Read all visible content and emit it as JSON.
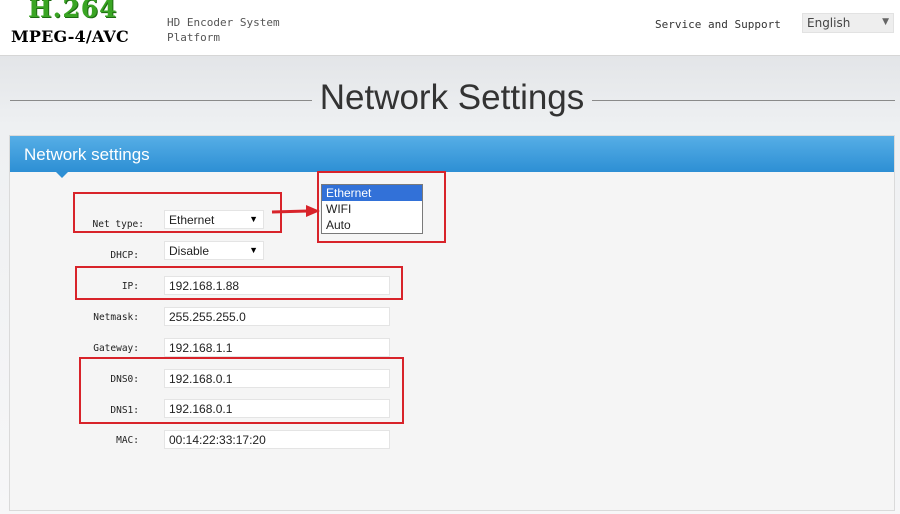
{
  "header": {
    "logo_top": "H.264",
    "logo_bottom": "MPEG-4/AVC",
    "system_title": "HD Encoder System Platform",
    "service_link": "Service and Support",
    "language": "English"
  },
  "page": {
    "title": "Network Settings"
  },
  "panel": {
    "title": "Network settings"
  },
  "form": {
    "net_type": {
      "label": "Net type:",
      "value": "Ethernet"
    },
    "dhcp": {
      "label": "DHCP:",
      "value": "Disable"
    },
    "ip": {
      "label": "IP:",
      "value": "192.168.1.88"
    },
    "netmask": {
      "label": "Netmask:",
      "value": "255.255.255.0"
    },
    "gateway": {
      "label": "Gateway:",
      "value": "192.168.1.1"
    },
    "dns0": {
      "label": "DNS0:",
      "value": "192.168.0.1"
    },
    "dns1": {
      "label": "DNS1:",
      "value": "192.168.0.1"
    },
    "mac": {
      "label": "MAC:",
      "value": "00:14:22:33:17:20"
    }
  },
  "net_type_dropdown": {
    "options": [
      "Ethernet",
      "WIFI",
      "Auto"
    ],
    "selected": "Ethernet"
  },
  "colors": {
    "accent_blue": "#2d8fd4",
    "annotation_red": "#d8232a",
    "selected_option": "#3271d8",
    "logo_green": "#3aa524"
  }
}
